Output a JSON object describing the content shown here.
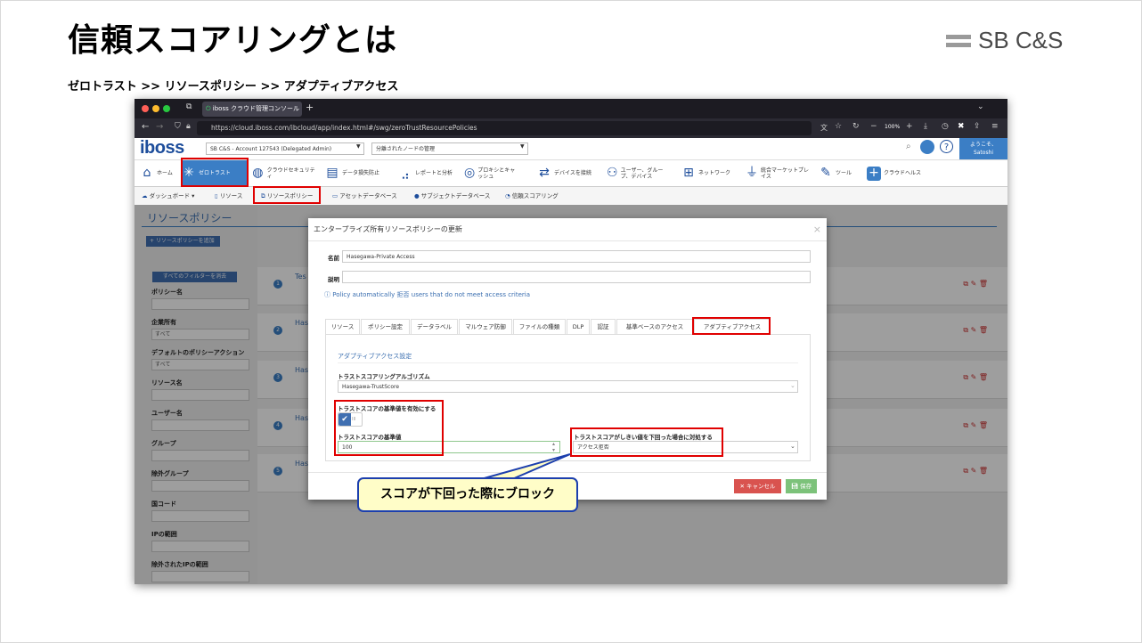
{
  "slide": {
    "title": "信頼スコアリングとは",
    "brand": "SB C&S",
    "breadcrumb": "ゼロトラスト >> リソースポリシー >> アダプティブアクセス",
    "callout": "スコアが下回った際にブロック"
  },
  "browser": {
    "tab_title": "iboss クラウド管理コンソール",
    "url": "https://cloud.iboss.com/ibcloud/app/index.html#/swg/zeroTrustResourcePolicies",
    "zoom": "100%"
  },
  "app": {
    "logo": "iboss",
    "account_select": "SB C&S - Account 127543 (Delegated Admin)",
    "node_select": "分離されたノードの管理",
    "user_greeting": "ようこそ、",
    "user_name": "Satoshi",
    "nav": [
      "ホーム",
      "ゼロトラスト",
      "クラウドセキュリティ",
      "データ損失防止",
      "レポートと分析",
      "プロキシとキャッシュ",
      "デバイスを接続",
      "ユーザー、グループ、デバイス",
      "ネットワーク",
      "統合マーケットプレイス",
      "ツール",
      "クラウドヘルス"
    ],
    "subnav": [
      "ダッシュボード",
      "リソース",
      "リソースポリシー",
      "アセットデータベース",
      "サブジェクトデータベース",
      "信頼スコアリング"
    ],
    "page_title": "リソースポリシー",
    "add_policy": "リソースポリシーを追加",
    "clear_filters": "すべてのフィルターを消去",
    "filters": [
      {
        "label": "ポリシー名",
        "value": ""
      },
      {
        "label": "企業所有",
        "value": "すべて"
      },
      {
        "label": "デフォルトのポリシーアクション",
        "value": "すべて"
      },
      {
        "label": "リソース名",
        "value": ""
      },
      {
        "label": "ユーザー名",
        "value": ""
      },
      {
        "label": "グループ",
        "value": ""
      },
      {
        "label": "除外グループ",
        "value": ""
      },
      {
        "label": "国コード",
        "value": ""
      },
      {
        "label": "IPの範囲",
        "value": ""
      },
      {
        "label": "除外されたIPの範囲",
        "value": ""
      }
    ],
    "rows": [
      {
        "num": "1",
        "name": "Tes"
      },
      {
        "num": "2",
        "name": "Has"
      },
      {
        "num": "3",
        "name": "Has"
      },
      {
        "num": "4",
        "name": "Has"
      },
      {
        "num": "5",
        "name": "Has"
      }
    ]
  },
  "dialog": {
    "title": "エンタープライズ所有リソースポリシーの更新",
    "name_label": "名前",
    "name_value": "Hasegawa-Private Access",
    "desc_label": "説明",
    "desc_value": "",
    "policy_note": "Policy automatically 拒否 users that do not meet access criteria",
    "tabs": [
      "リソース",
      "ポリシー設定",
      "データラベル",
      "マルウェア防御",
      "ファイルの種類",
      "DLP",
      "認証",
      "基準ベースのアクセス",
      "アダプティブアクセス"
    ],
    "active_tab": "アダプティブアクセス",
    "section_title": "アダプティブアクセス設定",
    "algo_label": "トラストスコアリングアルゴリズム",
    "algo_value": "Hasegawa-TrustScore",
    "enable_label": "トラストスコアの基準値を有効にする",
    "enable_on": true,
    "toggle_off_text": "III",
    "threshold_label": "トラストスコアの基準値",
    "threshold_value": "100",
    "action_label": "トラストスコアがしきい値を下回った場合に対処する",
    "action_value": "アクセス拒否",
    "cancel": "キャンセル",
    "save": "保存"
  },
  "colors": {
    "highlight": "#e00000",
    "accent": "#3f6fb1",
    "callout_bg": "#fffdc8",
    "callout_border": "#1c3fae"
  }
}
